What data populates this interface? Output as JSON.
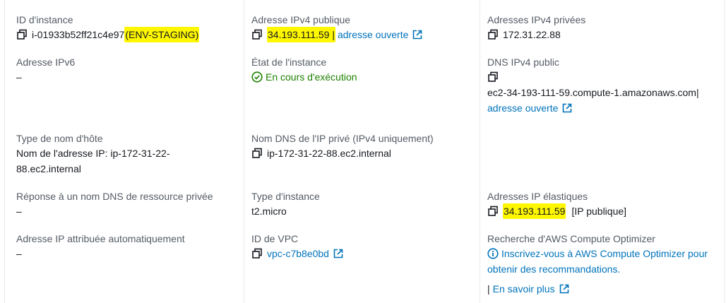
{
  "col1": {
    "instance_id": {
      "label": "ID d'instance",
      "value": "i-01933b52ff21c4e97",
      "name_tag": "(ENV-STAGING)"
    },
    "ipv6": {
      "label": "Adresse IPv6",
      "value": "–"
    },
    "hostname_type": {
      "label": "Type de nom d'hôte",
      "value_line1": "Nom de l'adresse IP: ip-172-31-22-",
      "value_line2": "88.ec2.internal"
    },
    "dns_answer": {
      "label": "Réponse à un nom DNS de ressource privée",
      "value": "–"
    },
    "auto_ip": {
      "label": "Adresse IP attribuée automatiquement",
      "value": "–"
    }
  },
  "col2": {
    "public_ipv4": {
      "label": "Adresse IPv4 publique",
      "value": "34.193.111.59",
      "separator": "|",
      "link": "adresse ouverte"
    },
    "instance_state": {
      "label": "État de l'instance",
      "value": "En cours d'exécution"
    },
    "private_dns": {
      "label": "Nom DNS de l'IP privé (IPv4 uniquement)",
      "value": "ip-172-31-22-88.ec2.internal"
    },
    "instance_type": {
      "label": "Type d'instance",
      "value": "t2.micro"
    },
    "vpc": {
      "label": "ID de VPC",
      "value": "vpc-c7b8e0bd"
    }
  },
  "col3": {
    "private_ipv4": {
      "label": "Adresses IPv4 privées",
      "value": "172.31.22.88"
    },
    "public_dns": {
      "label": "DNS IPv4 public",
      "value": "ec2-34-193-111-59.compute-1.amazonaws.com",
      "separator": "|",
      "link": "adresse ouverte"
    },
    "elastic_ip": {
      "label": "Adresses IP élastiques",
      "value": "34.193.111.59",
      "suffix": "[IP publique]"
    },
    "optimizer": {
      "label": "Recherche d'AWS Compute Optimizer",
      "link_line1": "Inscrivez-vous à AWS Compute Optimizer pour",
      "link_line2": "obtenir des recommandations.",
      "separator": "|",
      "learn_more": "En savoir plus"
    }
  },
  "colors": {
    "link": "#0073bb",
    "label": "#545b64",
    "text": "#16191f",
    "success": "#1d8102",
    "highlight": "#fff700",
    "divider": "#eaeded"
  }
}
